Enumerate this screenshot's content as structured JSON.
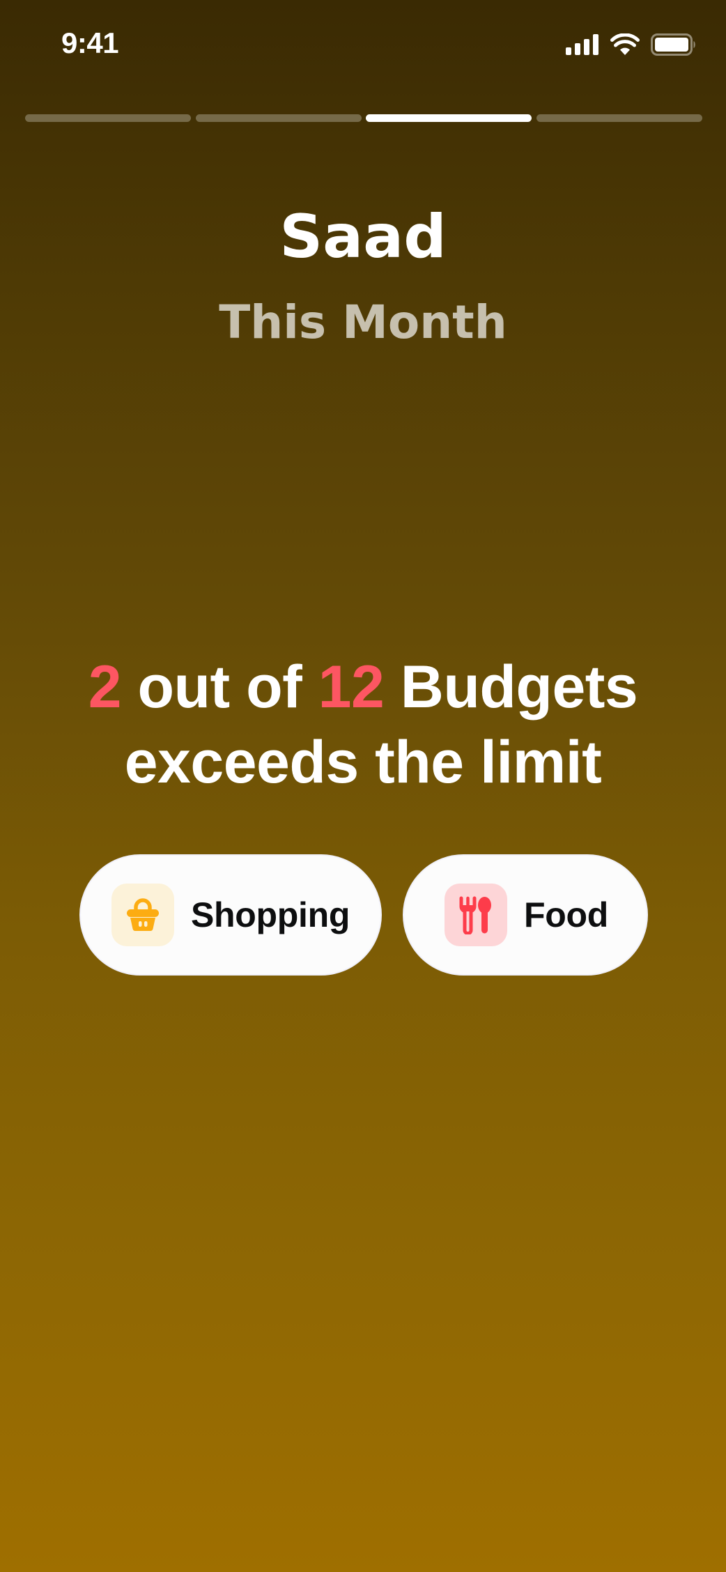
{
  "status_bar": {
    "time": "9:41"
  },
  "progress": {
    "total_segments": 4,
    "active_segment": 3
  },
  "header": {
    "name": "Saad",
    "period": "This Month"
  },
  "headline": {
    "exceeded_count": "2",
    "text_out_of": "out of",
    "total_count": "12",
    "text_budgets": "Budgets",
    "line2": "exceeds the limit"
  },
  "categories": [
    {
      "label": "Shopping",
      "icon": "shopping-basket-icon",
      "icon_color": "#fcac12",
      "icon_bg": "#fcf2d9"
    },
    {
      "label": "Food",
      "icon": "restaurant-icon",
      "icon_color": "#fd3c4a",
      "icon_bg": "#fdd5d7"
    }
  ],
  "colors": {
    "highlight_number": "#fd5662",
    "gradient_top": "#3a2a03",
    "gradient_bottom": "#9f6f00"
  }
}
